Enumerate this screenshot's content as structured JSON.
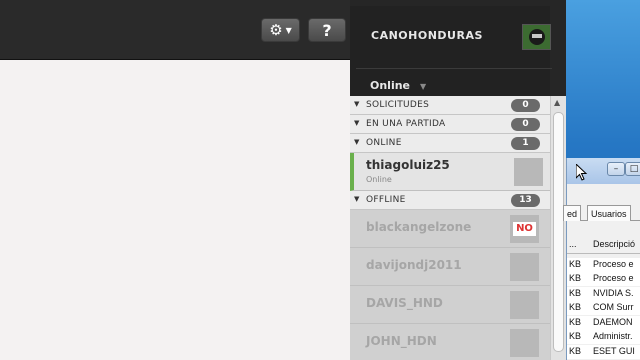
{
  "toolbar": {
    "settings_icon": "gear-icon",
    "help_label": "?"
  },
  "friends": {
    "username": "CANOHONDURAS",
    "status": "Online",
    "sections": {
      "solicitudes": {
        "label": "SOLICITUDES",
        "count": "0"
      },
      "partida": {
        "label": "EN UNA PARTIDA",
        "count": "0"
      },
      "online": {
        "label": "ONLINE",
        "count": "1"
      },
      "offline": {
        "label": "OFFLINE",
        "count": "13"
      }
    },
    "online_friend": {
      "name": "thiagoluiz25",
      "status": "Online"
    },
    "offline_friends": [
      "blackangelzone",
      "davijondj2011",
      "DAVIS_HND",
      "JOHN_HDN"
    ],
    "no_badge": "NO"
  },
  "task_manager": {
    "min_label": "–",
    "max_label": "□",
    "tabs": [
      "ed",
      "Usuarios"
    ],
    "header": {
      "col1": "...",
      "col2": "Descripció"
    },
    "rows": [
      {
        "size": "KB",
        "desc": "Proceso e"
      },
      {
        "size": "KB",
        "desc": "Proceso e"
      },
      {
        "size": "KB",
        "desc": "NVIDIA S."
      },
      {
        "size": "KB",
        "desc": "COM Surr"
      },
      {
        "size": "KB",
        "desc": "DAEMON"
      },
      {
        "size": "KB",
        "desc": "Administr."
      },
      {
        "size": "KB",
        "desc": "ESET GUI"
      }
    ]
  },
  "colors": {
    "online_accent": "#6ab04c",
    "panel_bg": "#262626"
  }
}
